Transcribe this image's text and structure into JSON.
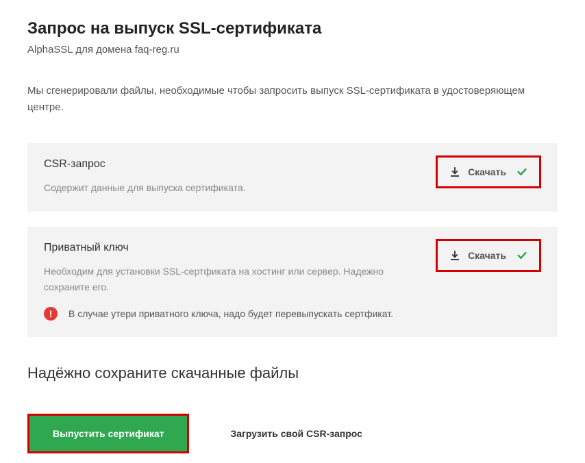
{
  "header": {
    "title": "Запрос на выпуск SSL-сертификата",
    "subtitle": "AlphaSSL для домена faq-reg.ru"
  },
  "intro": "Мы сгенерировали файлы, необходимые чтобы запросить выпуск SSL-сертификата в удостоверяющем центре.",
  "cards": {
    "csr": {
      "title": "CSR-запрос",
      "desc": "Содержит данные для выпуска сертификата.",
      "download_label": "Скачать"
    },
    "key": {
      "title": "Приватный ключ",
      "desc": "Необходим для установки SSL-сертфиката на хостинг или сервер. Надежно сохраните его.",
      "download_label": "Скачать",
      "warning": "В случае утери приватного ключа, надо будет перевыпускать сертфикат."
    }
  },
  "section_title": "Надёжно сохраните скачанные файлы",
  "actions": {
    "issue_label": "Выпустить сертификат",
    "upload_label": "Загрузить свой CSR-запрос"
  }
}
